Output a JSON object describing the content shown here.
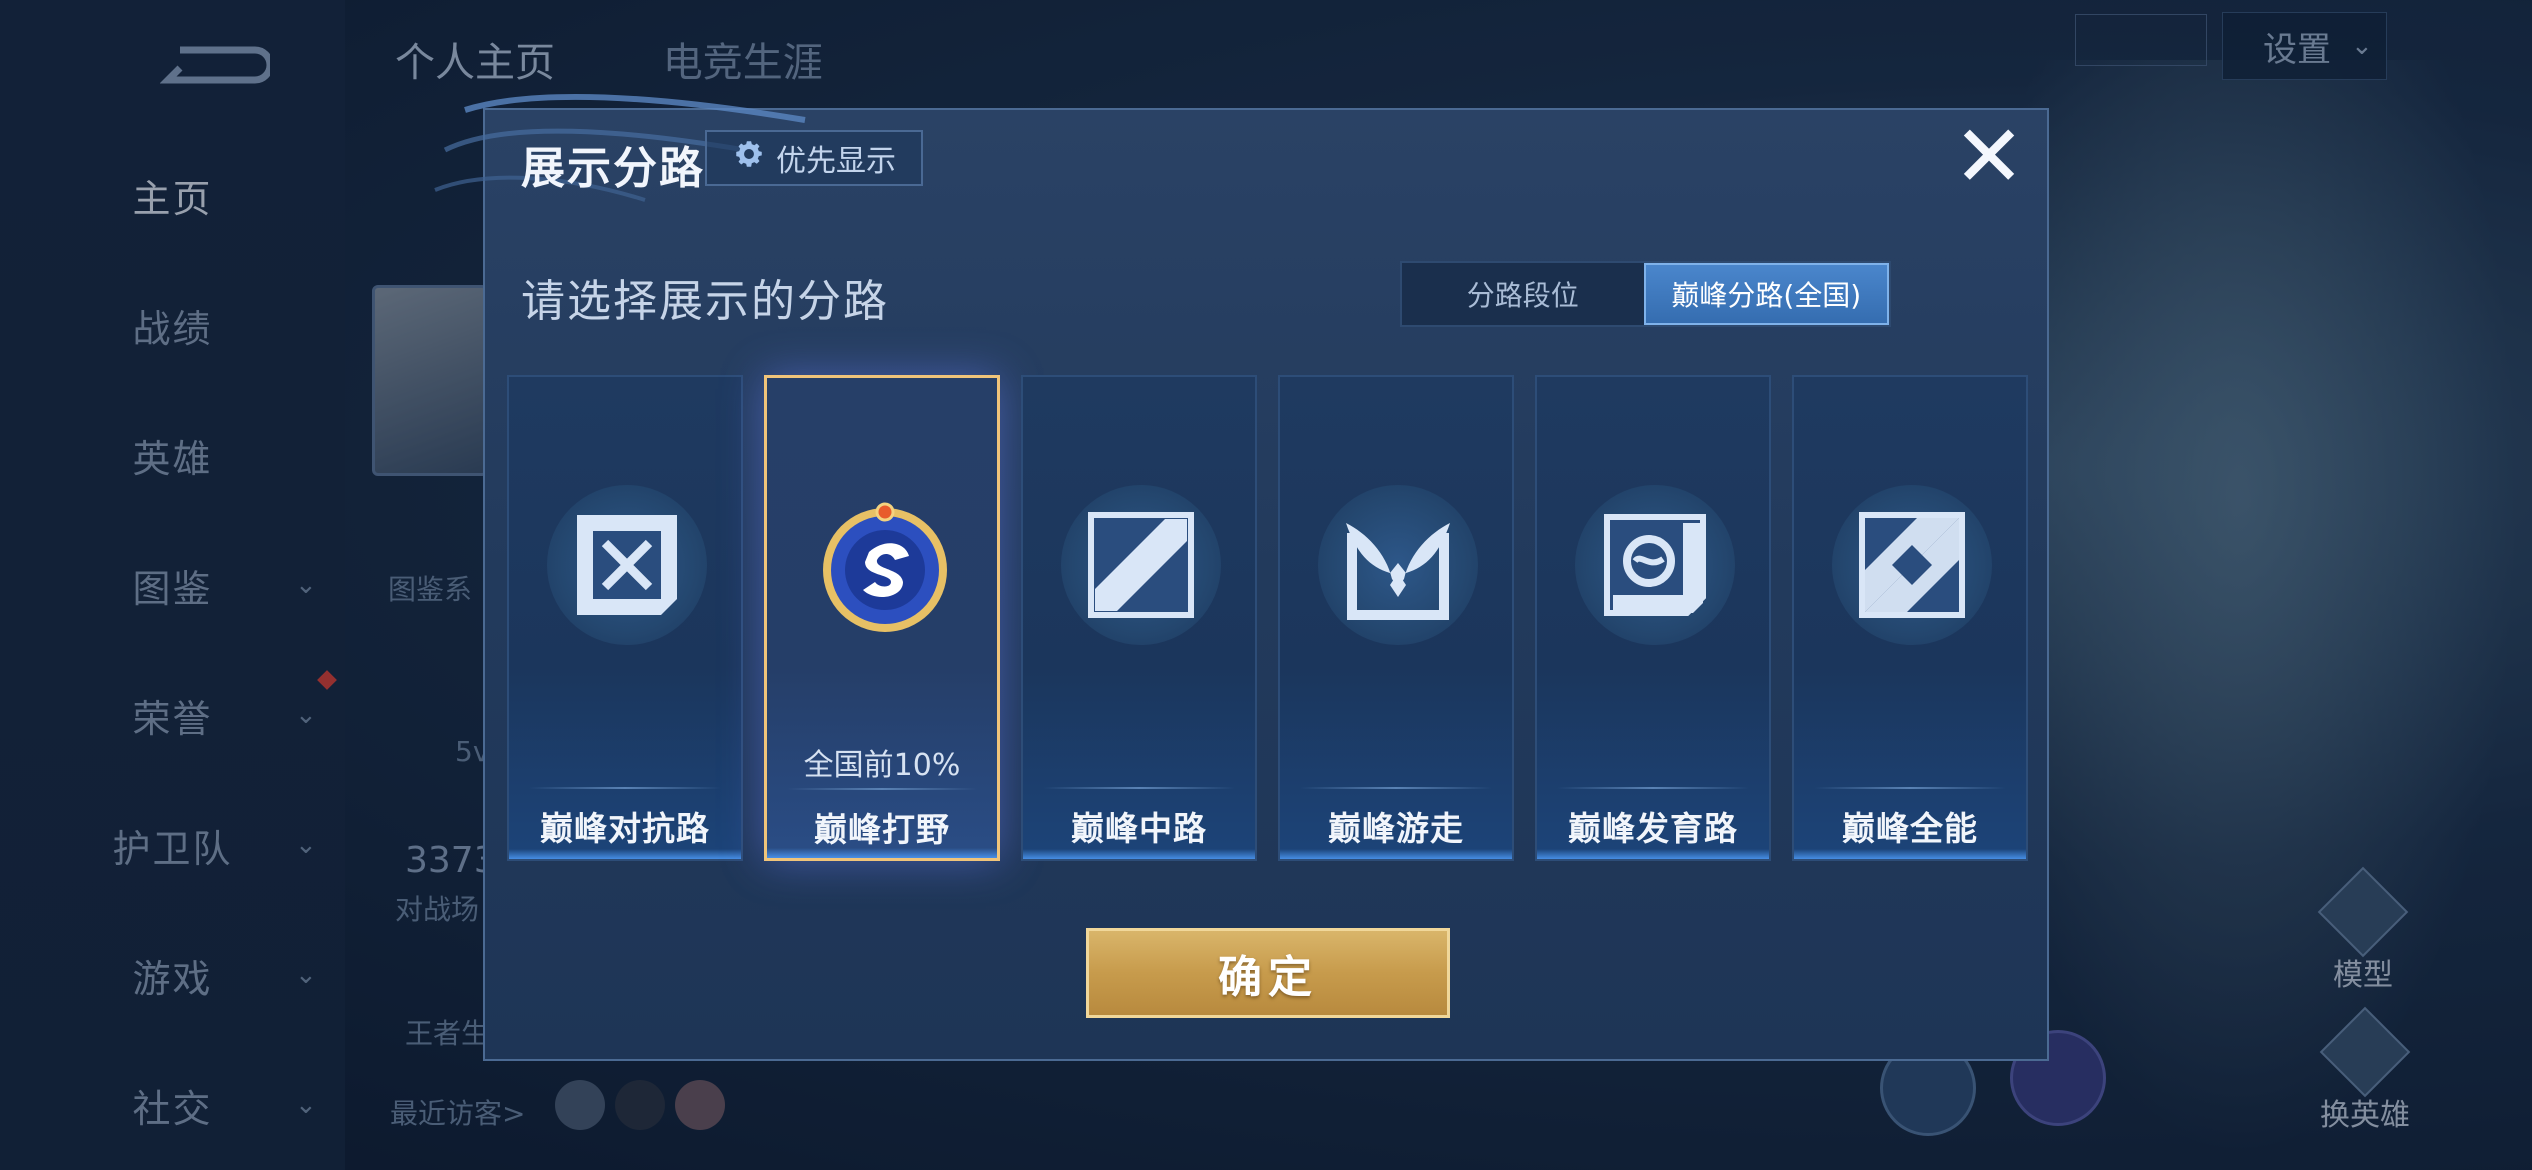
{
  "background": {
    "sidebar": {
      "items": [
        {
          "label": "主页",
          "has_chevron": false
        },
        {
          "label": "战绩",
          "has_chevron": false
        },
        {
          "label": "英雄",
          "has_chevron": false
        },
        {
          "label": "图鉴",
          "has_chevron": true
        },
        {
          "label": "荣誉",
          "has_chevron": true
        },
        {
          "label": "护卫队",
          "has_chevron": true
        },
        {
          "label": "游戏",
          "has_chevron": true
        },
        {
          "label": "社交",
          "has_chevron": true
        }
      ]
    },
    "top_tabs": [
      "个人主页",
      "电竞生涯"
    ],
    "settings_label": "设置",
    "partial_texts": {
      "catalog": "图鉴系",
      "wins": "5v",
      "count": "3373",
      "matches": "对战场",
      "kingdom": "王者生",
      "visitors": "最近访客>"
    },
    "model_label": "模型",
    "switch_hero_label": "换英雄"
  },
  "modal": {
    "title": "展示分路",
    "priority_button": "优先显示",
    "subtitle": "请选择展示的分路",
    "segments": {
      "left": "分路段位",
      "right": "巅峰分路(全国)",
      "selected": "right"
    },
    "cards": [
      {
        "label": "巅峰对抗路",
        "icon": "clash-lane-icon",
        "selected": false,
        "rank": ""
      },
      {
        "label": "巅峰打野",
        "icon": "jungle-rank-badge-icon",
        "selected": true,
        "rank": "全国前10%"
      },
      {
        "label": "巅峰中路",
        "icon": "mid-lane-icon",
        "selected": false,
        "rank": ""
      },
      {
        "label": "巅峰游走",
        "icon": "roam-icon",
        "selected": false,
        "rank": ""
      },
      {
        "label": "巅峰发育路",
        "icon": "farm-lane-icon",
        "selected": false,
        "rank": ""
      },
      {
        "label": "巅峰全能",
        "icon": "all-round-icon",
        "selected": false,
        "rank": ""
      }
    ],
    "confirm_button": "确定"
  },
  "colors": {
    "accent_gold": "#f0c47a",
    "segment_active": "#4a86cc",
    "confirm_gold": "#c79b4c"
  }
}
